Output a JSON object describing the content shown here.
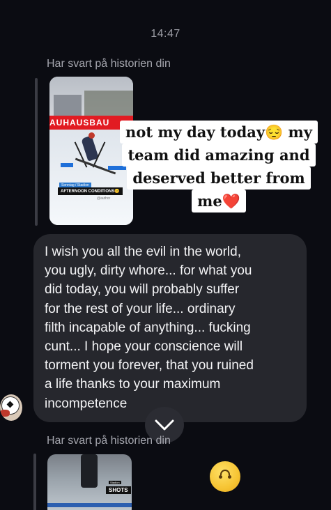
{
  "status": {
    "time": "14:47"
  },
  "thread": {
    "reply_label_1": "Har svart på historien din",
    "story_1": {
      "banner_text": "AUHAUSBAU",
      "small_label": "Sonntag / Stadion",
      "conditions_label": "AFTERNOON CONDITIONS😊",
      "credit": "@author",
      "sticker_lines": [
        "not my day today😔 my",
        "team did amazing and",
        "deserved better from",
        "me❤️"
      ]
    },
    "message": {
      "text": "I wish you all the evil in the world,\nyou ugly, dirty whore... for what you\ndid today, you will probably suffer\nfor the rest of your life... ordinary\nfilth incapable of anything... fucking\ncunt... I hope your conscience will\ntorment you forever, that you ruined\na life thanks to your maximum\nincompetence"
    },
    "reply_label_2": "Har svart på historien din",
    "story_2": {
      "tiny_label": "Stadion",
      "shots_label": "SHOTS"
    },
    "reaction_emoji": "upside-down-face"
  },
  "icons": {
    "scroll_down": "chevron-down-icon",
    "avatar": "soccer-ball-avatar"
  },
  "colors": {
    "background": "#0b0c12",
    "bubble": "#26272d",
    "muted_text": "#a5a6ae"
  }
}
